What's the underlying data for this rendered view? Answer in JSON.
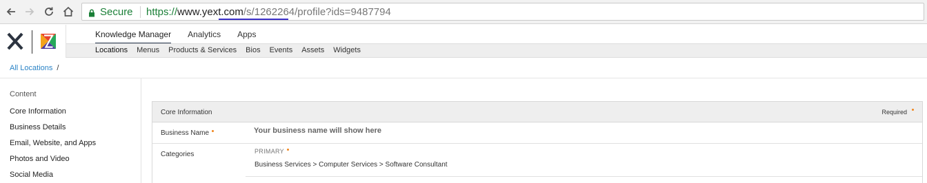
{
  "browser": {
    "secure_label": "Secure",
    "url": {
      "scheme": "https://",
      "host": "www.yext.com",
      "path_pre": "/s/",
      "account_id": "1262264",
      "path_post": "/profile?ids=9487794"
    },
    "icons": [
      "back-icon",
      "forward-icon",
      "reload-icon",
      "home-icon",
      "lock-icon"
    ]
  },
  "app": {
    "top_tabs": [
      {
        "label": "Knowledge Manager",
        "active": true
      },
      {
        "label": "Analytics",
        "active": false
      },
      {
        "label": "Apps",
        "active": false
      }
    ],
    "sub_tabs": [
      {
        "label": "Locations",
        "active": true
      },
      {
        "label": "Menus",
        "active": false
      },
      {
        "label": "Products & Services",
        "active": false
      },
      {
        "label": "Bios",
        "active": false
      },
      {
        "label": "Events",
        "active": false
      },
      {
        "label": "Assets",
        "active": false
      },
      {
        "label": "Widgets",
        "active": false
      }
    ]
  },
  "breadcrumb": {
    "link": "All Locations",
    "separator": "/"
  },
  "sidebar": {
    "heading": "Content",
    "items": [
      {
        "label": "Core Information"
      },
      {
        "label": "Business Details"
      },
      {
        "label": "Email, Website, and Apps"
      },
      {
        "label": "Photos and Video"
      },
      {
        "label": "Social Media"
      }
    ]
  },
  "panel": {
    "title": "Core Information",
    "required_label": "Required",
    "rows": {
      "business_name": {
        "label": "Business Name",
        "placeholder": "Your business name will show here"
      },
      "categories": {
        "label": "Categories",
        "primary_label": "PRIMARY",
        "path": "Business Services > Computer Services > Software Consultant"
      }
    }
  },
  "colors": {
    "secure_green": "#1a7f37",
    "link_blue": "#2a83c6",
    "required_orange": "#f0851c",
    "url_underline": "#3b2fc9"
  }
}
